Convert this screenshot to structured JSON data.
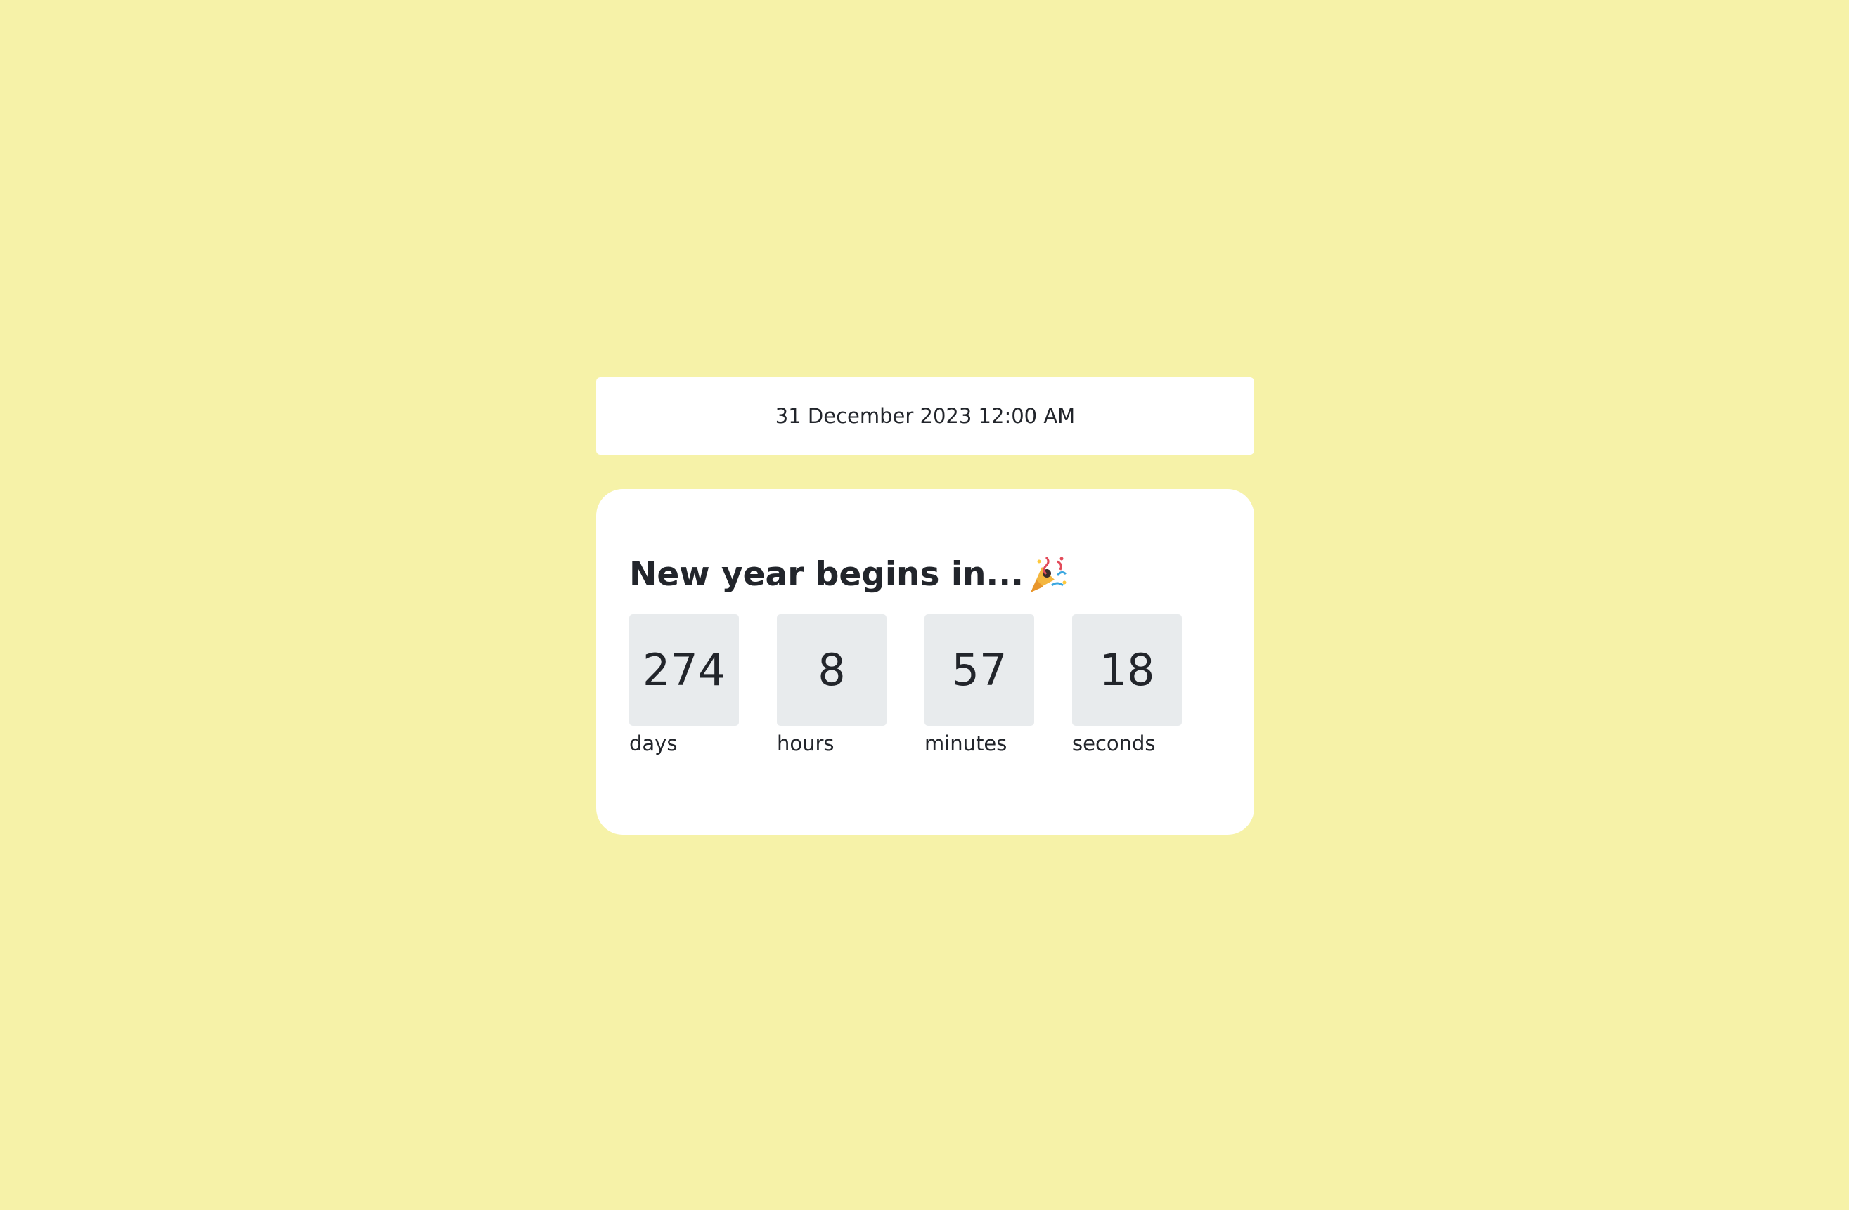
{
  "target_date": "31 December 2023 12:00 AM",
  "heading": "New year begins in...",
  "heading_icon": "party-popper-icon",
  "countdown": [
    {
      "value": "274",
      "label": "days"
    },
    {
      "value": "8",
      "label": "hours"
    },
    {
      "value": "57",
      "label": "minutes"
    },
    {
      "value": "18",
      "label": "seconds"
    }
  ],
  "colors": {
    "background": "#f6f2a8",
    "card": "#ffffff",
    "unit_box": "#e8ebed",
    "text": "#22252b"
  }
}
